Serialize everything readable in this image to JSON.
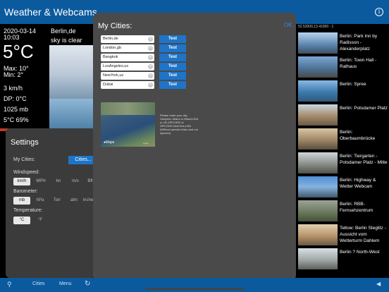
{
  "app": {
    "title": "Weather & Webcams",
    "info_icon": "i"
  },
  "weather": {
    "date": "2020-03-14",
    "time": "10:03",
    "temp": "5°C",
    "max": "Max: 10°",
    "min": "Min: 2°",
    "wind": "3 km/h",
    "dew_point": "DP: 0°C",
    "pressure": "1025 mb",
    "humidity": "5°C 69%",
    "location": "Berlin,de",
    "condition": "sky is clear"
  },
  "settings": {
    "title": "Settings",
    "my_cities_label": "My Cities:",
    "cities_button": "Cities...",
    "windspeed_label": "Windspeed:",
    "windspeed_options": [
      "km/h",
      "MPH",
      "kn",
      "m/s",
      "Bft"
    ],
    "barometer_label": "Barometer:",
    "barometer_options": [
      "mb",
      "hPa",
      "Torr",
      "atm",
      "inches"
    ],
    "temperature_label": "Temperature:",
    "temperature_options": [
      "°C",
      "°F"
    ]
  },
  "cities_modal": {
    "title": "My Cities:",
    "ok": "OK",
    "cities": [
      "Berlin,de",
      "London,gb",
      "Bangkok",
      "LosAngeles,us",
      "NewYork,us",
      "Dubai"
    ],
    "test_label": "Test",
    "map_logo": "Maps",
    "map_legal": "Legal",
    "help_text": "Please enter your city. Samples: Miami or Miami,USA or UK,ZIPCODE or ZIPCODE,NewYork,USA (Without special chars and not spaces!)"
  },
  "webcams": {
    "coords": "52.52000,13.41000 - 1",
    "items": [
      "Berlin: Park Inn by Radisson - Alexanderplatz",
      "Berlin: Town Hall - Rathaus",
      "Berlin: Spree",
      "Berlin: Potsdamer Platz",
      "Berlin: Oberbaumbrücke",
      "Berlin: Tiergarten - Potsdamer Platz - Mitte",
      "Berlin: Highway & Wetter Webcam",
      "Berlin: RBB-Fernsehzentrum",
      "Teltow: Berlin Steglitz - Aussicht vom Wetterturm Dahlem",
      "Berlin ? North-West"
    ]
  },
  "bottom": {
    "cities": "Cities",
    "menu": "Menu"
  },
  "colors": {
    "bar_blue": "#0b5a9e",
    "button_blue": "#1e74c9",
    "modal_bg": "#4a4a4a",
    "link_blue": "#2b8be6"
  }
}
